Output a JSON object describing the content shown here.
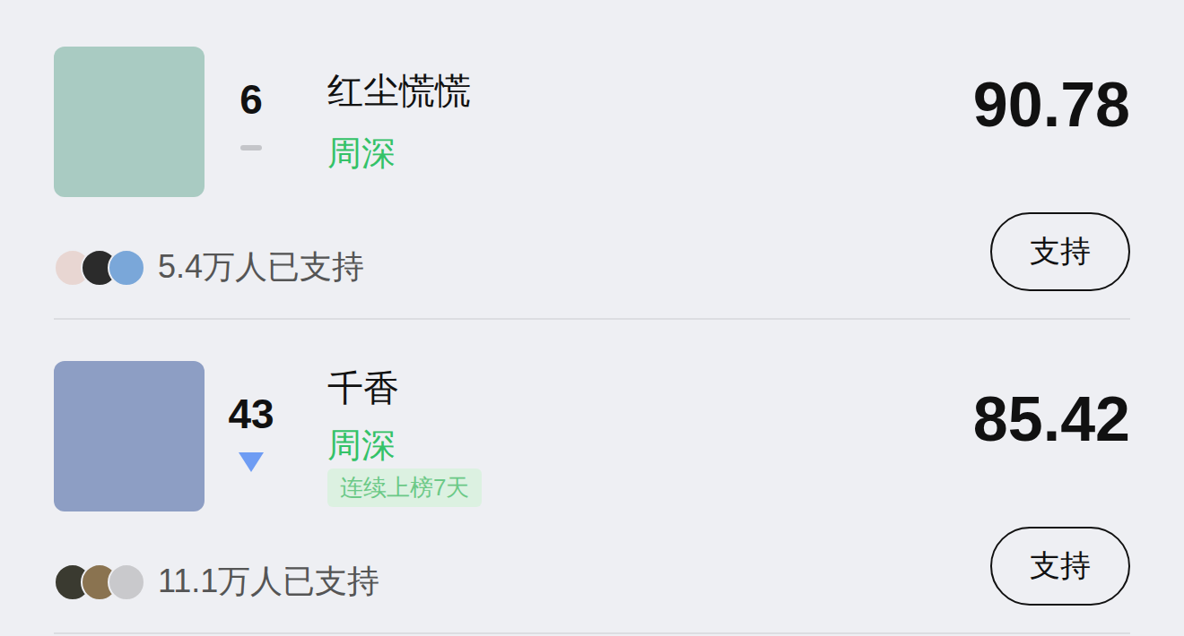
{
  "chart": {
    "items": [
      {
        "rank": "6",
        "trend": "flat",
        "title": "红尘慌慌",
        "artist": "周深",
        "score": "90.78",
        "supporters": "5.4万人已支持",
        "button": "支持"
      },
      {
        "rank": "43",
        "trend": "down",
        "title": "千香",
        "artist": "周深",
        "badge": "连续上榜7天",
        "score": "85.42",
        "supporters": "11.1万人已支持",
        "button": "支持"
      }
    ]
  }
}
